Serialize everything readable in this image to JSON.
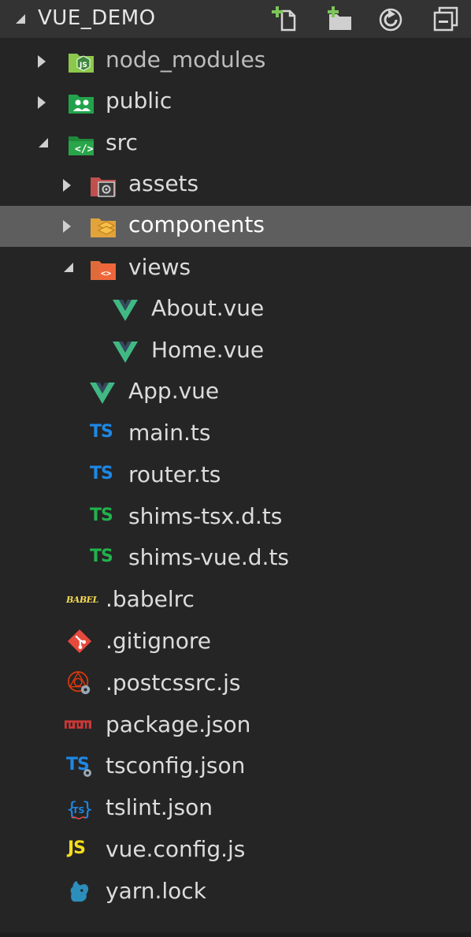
{
  "explorer": {
    "title": "VUE_DEMO",
    "actions": [
      {
        "name": "new-file-icon"
      },
      {
        "name": "new-folder-icon"
      },
      {
        "name": "refresh-icon"
      },
      {
        "name": "collapse-all-icon"
      }
    ]
  },
  "tree": {
    "node_modules": "node_modules",
    "public": "public",
    "src": "src",
    "assets": "assets",
    "components": "components",
    "views": "views",
    "about_vue": "About.vue",
    "home_vue": "Home.vue",
    "app_vue": "App.vue",
    "main_ts": "main.ts",
    "router_ts": "router.ts",
    "shims_tsx": "shims-tsx.d.ts",
    "shims_vue": "shims-vue.d.ts",
    "babelrc": ".babelrc",
    "gitignore": ".gitignore",
    "postcssrc": ".postcssrc.js",
    "package_json": "package.json",
    "tsconfig_json": "tsconfig.json",
    "tslint_json": "tslint.json",
    "vue_config": "vue.config.js",
    "yarn_lock": "yarn.lock"
  },
  "glyphs": {
    "ts": "TS",
    "js": "JS",
    "babel": "BABEL"
  },
  "colors": {
    "vue_green": "#41b883",
    "vue_dark": "#35495e",
    "ts_blue": "#1e88e5",
    "ts_green": "#22b24c",
    "js_yellow": "#f5de19",
    "git_red": "#e64a3c",
    "npm_red": "#cb3837",
    "selected_bg": "#5e5e5e"
  }
}
